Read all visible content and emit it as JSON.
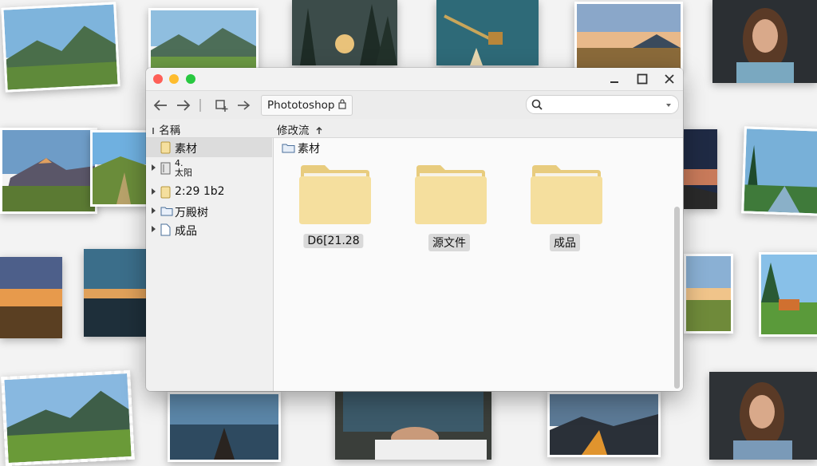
{
  "window": {
    "title_controls": [
      "minimize",
      "maximize",
      "close"
    ],
    "toolbar": {
      "back_icon": "arrow-left-icon",
      "forward_icon": "arrow-right-icon",
      "path": "Phototoshop"
    },
    "search": {
      "placeholder": ""
    },
    "columns": {
      "name": "名稱",
      "modified": "修改流"
    }
  },
  "sidebar": {
    "items": [
      {
        "label": "素材",
        "icon": "folder-icon",
        "selected": true
      },
      {
        "label": "4.\n太阳",
        "icon": "document-icon",
        "selected": false
      },
      {
        "label": "2:29 1b2",
        "icon": "folder-icon",
        "selected": false
      },
      {
        "label": "万殿树",
        "icon": "folder-icon",
        "selected": false
      },
      {
        "label": "成品",
        "icon": "document-icon",
        "selected": false
      }
    ]
  },
  "main": {
    "breadcrumb": "素材",
    "folders": [
      {
        "label": "D6[21.28"
      },
      {
        "label": "源文件"
      },
      {
        "label": "成品"
      }
    ]
  },
  "colors": {
    "folder": "#f5df9e",
    "folder_tab": "#e8cc7e",
    "selection": "#dcdcdc"
  }
}
